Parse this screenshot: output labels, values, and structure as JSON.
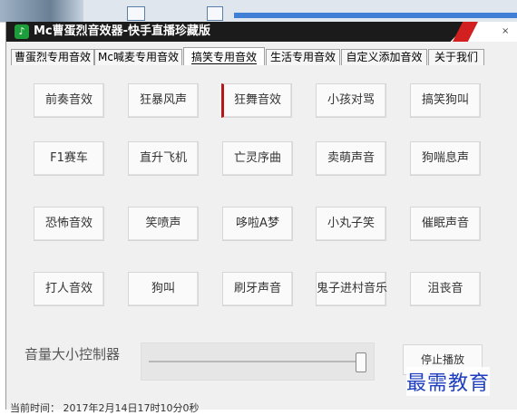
{
  "window": {
    "title": "Mc曹蛋烈音效器-快手直播珍藏版",
    "icon_name": "app-logo-icon",
    "close_label": "×"
  },
  "tabs": [
    {
      "label": "曹蛋烈专用音效",
      "active": false
    },
    {
      "label": "Mc喊麦专用音效",
      "active": false
    },
    {
      "label": "搞笑专用音效",
      "active": true
    },
    {
      "label": "生活专用音效",
      "active": false
    },
    {
      "label": "自定义添加音效",
      "active": false
    },
    {
      "label": "关于我们",
      "active": false
    }
  ],
  "sound_buttons": [
    [
      "前奏音效",
      "狂暴风声",
      "狂舞音效",
      "小孩对骂",
      "搞笑狗叫"
    ],
    [
      "F1赛车",
      "直升飞机",
      "亡灵序曲",
      "卖萌声音",
      "狗喘息声"
    ],
    [
      "恐怖音效",
      "笑喷声",
      "哆啦A梦",
      "小丸子笑",
      "催眠声音"
    ],
    [
      "打人音效",
      "狗叫",
      "刷牙声音",
      "鬼子进村音乐",
      "沮丧音"
    ]
  ],
  "active_button": "狂舞音效",
  "volume": {
    "label": "音量大小控制器",
    "level_fraction": 1.0
  },
  "stop_button": "停止播放",
  "status": {
    "text": "当前时间：  2017年2月14日17时10分0秒"
  },
  "watermark": "最需教育",
  "colors": {
    "title_bar": "#1b1b1b",
    "title_accent": "#d21f1f",
    "active_marker": "#b51a1a",
    "watermark": "#1f3fbf"
  }
}
